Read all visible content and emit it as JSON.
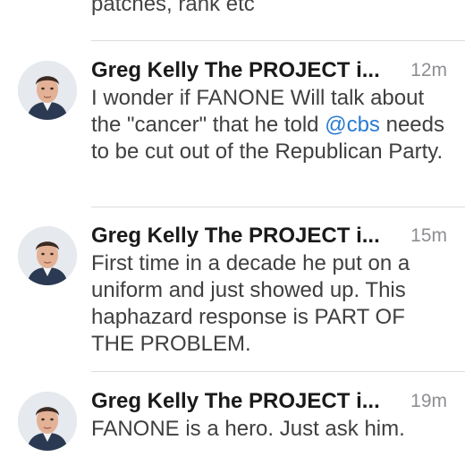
{
  "top_fragment": "patches, rank etc",
  "tweets": [
    {
      "author": "Greg Kelly The PROJECT i...",
      "time": "12m",
      "text_pre": "I wonder if FANONE Will talk about the \"cancer\" that he told ",
      "mention": "@cbs",
      "text_post": " needs to be cut out of the Republican Party."
    },
    {
      "author": "Greg Kelly The PROJECT i...",
      "time": "15m",
      "text": "First time in a decade he put on a uniform and just showed up. This haphazard response is PART OF THE PROBLEM."
    },
    {
      "author": "Greg Kelly The PROJECT i...",
      "time": "19m",
      "text": "FANONE is a hero. Just ask him."
    }
  ],
  "colors": {
    "mention": "#2a7bd0",
    "timestamp": "#8e8e93",
    "author": "#1a1a1a"
  }
}
